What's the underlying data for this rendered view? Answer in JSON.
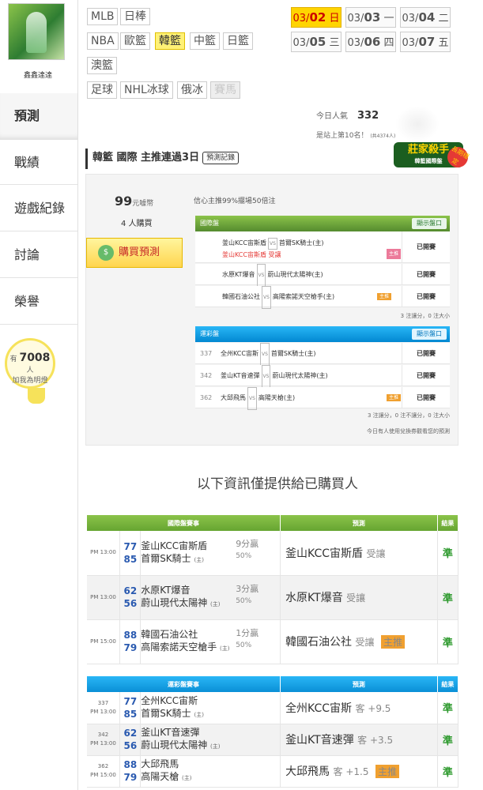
{
  "profile": {
    "name": "鑫鑫達達"
  },
  "sidebar": {
    "tabs": [
      "預測",
      "戰績",
      "遊戲紀錄",
      "討論",
      "榮譽"
    ],
    "active": 0
  },
  "fans": {
    "prefix": "有",
    "count": "7008",
    "unit": "人",
    "cta": "加我為明燈"
  },
  "sports": {
    "row1": [
      "MLB",
      "日棒"
    ],
    "row2": [
      "NBA",
      "歐籃",
      "韓籃",
      "中籃",
      "日籃"
    ],
    "row3": [
      "澳籃"
    ],
    "row4": [
      "足球",
      "NHL冰球",
      "俄冰",
      "賽馬"
    ],
    "active": "韓籃",
    "disabled": "賽馬"
  },
  "dates": [
    {
      "md": "03/",
      "d": "02",
      "wd": "日",
      "active": true
    },
    {
      "md": "03/",
      "d": "03",
      "wd": "一"
    },
    {
      "md": "03/",
      "d": "04",
      "wd": "二"
    },
    {
      "md": "03/",
      "d": "05",
      "wd": "三"
    },
    {
      "md": "03/",
      "d": "06",
      "wd": "四"
    },
    {
      "md": "03/",
      "d": "07",
      "wd": "五"
    }
  ],
  "stats": {
    "popularity_label": "今日人氣",
    "popularity": "332",
    "rank_text": "是站上第10名！",
    "rank_small": "(共4374人)"
  },
  "headline": {
    "text": "韓籃 國際 主推連過3日",
    "record_btn": "預測記錄"
  },
  "badge": {
    "title": "莊家殺手",
    "sub": "韓籃國際盤",
    "tag": "長期穩定"
  },
  "purchase": {
    "price": "99",
    "price_unit": "元噱幣",
    "buyers": "4 人購買",
    "buy_label": "購買預測",
    "confidence": "信心主推99%擺場50倍注"
  },
  "intl": {
    "header": "國際盤",
    "show_btn": "顯示盤口",
    "rows": [
      {
        "home": "釜山KCC宙斯盾",
        "away": "首爾SK騎士(主)",
        "pick": "釜山KCC宙斯盾 受讓",
        "tag": "主推",
        "status": "已開賽"
      },
      {
        "home": "水原KT爆音",
        "away": "蔚山現代太陽神(主)",
        "status": "已開賽"
      },
      {
        "home": "韓國石油公社",
        "away": "高陽索諾天空槍手(主)",
        "tag": "主推",
        "status": "已開賽"
      }
    ],
    "foot": "3 注讓分，0 注大小"
  },
  "lottery": {
    "header": "運彩盤",
    "show_btn": "顯示盤口",
    "rows": [
      {
        "no": "337",
        "home": "全州KCC宙斯",
        "away": "首爾SK騎士(主)",
        "status": "已開賽"
      },
      {
        "no": "342",
        "home": "釜山KT音速彈",
        "away": "蔚山現代太陽神(主)",
        "status": "已開賽"
      },
      {
        "no": "362",
        "home": "大邱飛馬",
        "away": "高陽天槍(主)",
        "tag": "主推",
        "status": "已開賽"
      }
    ],
    "foot": "3 注讓分，0 注不讓分，0 注大小",
    "foot2": "今日有人使用兌換券觀看您的預測"
  },
  "buyers_only": "以下資訊僅提供給已購買人",
  "table_intl": {
    "headers": [
      "國際盤賽事",
      "預測",
      "結果"
    ],
    "rows": [
      {
        "time": "PM 13:00",
        "s1": "77",
        "t1": "釜山KCC宙斯盾",
        "s2": "85",
        "t2": "首爾SK騎士",
        "h": "(主)",
        "res": "9分贏",
        "pct": "50%",
        "pick": "釜山KCC宙斯盾",
        "pick_note": "受讓",
        "result": "準"
      },
      {
        "time": "PM 13:00",
        "s1": "62",
        "t1": "水原KT爆音",
        "s2": "56",
        "t2": "蔚山現代太陽神",
        "h": "(主)",
        "res": "3分贏",
        "pct": "50%",
        "pick": "水原KT爆音",
        "pick_note": "受讓",
        "result": "準"
      },
      {
        "time": "PM 15:00",
        "s1": "88",
        "t1": "韓國石油公社",
        "s2": "79",
        "t2": "高陽索諾天空槍手",
        "h": "(主)",
        "res": "1分贏",
        "pct": "50%",
        "pick": "韓國石油公社",
        "pick_note": "受讓",
        "result": "準"
      }
    ]
  },
  "table_lottery": {
    "headers": [
      "運彩盤賽事",
      "預測",
      "結果"
    ],
    "rows": [
      {
        "no": "337",
        "time": "PM 13:00",
        "s1": "77",
        "t1": "全州KCC宙斯",
        "s2": "85",
        "t2": "首爾SK騎士",
        "h": "(主)",
        "pick": "全州KCC宙斯",
        "pick_note": "客 +9.5",
        "result": "準"
      },
      {
        "no": "342",
        "time": "PM 13:00",
        "s1": "62",
        "t1": "釜山KT音速彈",
        "s2": "56",
        "t2": "蔚山現代太陽神",
        "h": "(主)",
        "pick": "釜山KT音速彈",
        "pick_note": "客 +3.5",
        "result": "準"
      },
      {
        "no": "362",
        "time": "PM 15:00",
        "s1": "88",
        "t1": "大邱飛馬",
        "s2": "79",
        "t2": "高陽天槍",
        "h": "(主)",
        "pick": "大邱飛馬",
        "pick_note": "客 +1.5",
        "result": "準"
      }
    ]
  }
}
